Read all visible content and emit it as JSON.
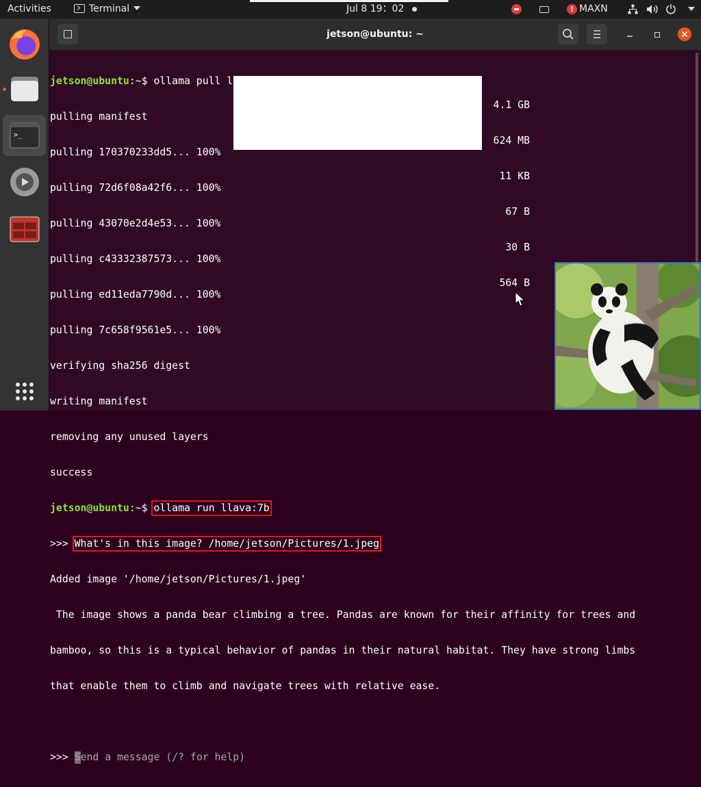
{
  "topbar": {
    "activities": "Activities",
    "app_menu": "Terminal",
    "clock": "Jul 8  19：02",
    "power_mode": "MAXN"
  },
  "dock": {
    "items": [
      "firefox-icon",
      "files-icon",
      "terminal-icon",
      "settings-icon",
      "app-icon",
      "show-apps-icon"
    ]
  },
  "window": {
    "title": "jetson@ubuntu: ~"
  },
  "terminal": {
    "prompt": "jetson@ubuntu",
    "prompt_suffix": ":~$ ",
    "cmd1": "ollama pull llava:7b",
    "l_manifest": "pulling manifest",
    "pulls": [
      {
        "text": "pulling 170370233dd5... 100%",
        "size": "4.1 GB"
      },
      {
        "text": "pulling 72d6f08a42f6... 100%",
        "size": "624 MB"
      },
      {
        "text": "pulling 43070e2d4e53... 100%",
        "size": "11 KB"
      },
      {
        "text": "pulling c43332387573... 100%",
        "size": "67 B"
      },
      {
        "text": "pulling ed11eda7790d... 100%",
        "size": "30 B"
      },
      {
        "text": "pulling 7c658f9561e5... 100%",
        "size": "564 B"
      }
    ],
    "l_verify": "verifying sha256 digest",
    "l_write": "writing manifest",
    "l_remove": "removing any unused layers",
    "l_success": "success",
    "cmd2": "ollama run llava:7b",
    "chevrons": ">>> ",
    "question": "What's in this image? /home/jetson/Pictures/1.jpeg",
    "added": "Added image '/home/jetson/Pictures/1.jpeg'",
    "answer_1": " The image shows a panda bear climbing a tree. Pandas are known for their affinity for trees and",
    "answer_2": "bamboo, so this is a typical behavior of pandas in their natural habitat. They have strong limbs",
    "answer_3": "that enable them to climb and navigate trees with relative ease.",
    "placeholder_first": "S",
    "placeholder_rest": "end a message (/? for help)"
  },
  "colors": {
    "terminal_bg": "#300a24",
    "prompt": "#8ae234",
    "highlight": "#e8141c",
    "accent": "#e95420"
  }
}
